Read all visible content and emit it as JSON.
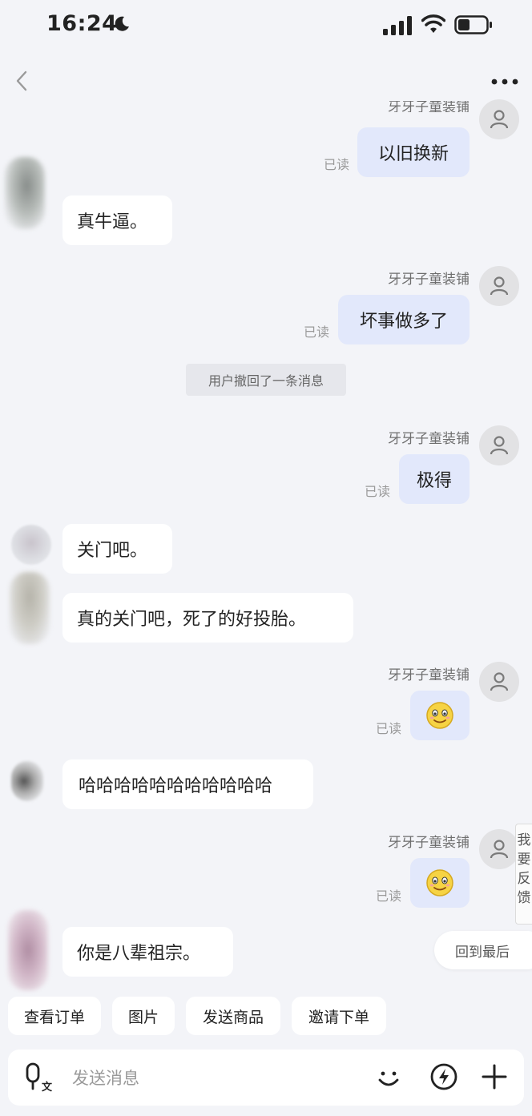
{
  "status_bar": {
    "time": "16:24"
  },
  "shop": {
    "name": "牙牙子童装铺"
  },
  "read_label": "已读",
  "messages": {
    "m1": "以旧换新",
    "m2": "真牛逼。",
    "m3": "坏事做多了",
    "recall": "用户撤回了一条消息",
    "m4": "极得",
    "m5": "关门吧。",
    "m6": "真的关门吧，死了的好投胎。",
    "m7": "哈哈哈哈哈哈哈哈哈哈哈",
    "m8": "你是八辈祖宗。"
  },
  "shop_name_cut": "牙牙子童装铺",
  "feedback": {
    "label": "我要反馈"
  },
  "back_to_latest": "回到最后",
  "quick_actions": [
    "查看订单",
    "图片",
    "发送商品",
    "邀请下单"
  ],
  "input": {
    "placeholder": "发送消息"
  },
  "icons": [
    "back-icon",
    "more-icon",
    "moon-icon",
    "signal-icon",
    "wifi-icon",
    "battery-icon",
    "person-icon",
    "smiley-icon",
    "voice-icon",
    "emoji-icon",
    "flash-icon",
    "plus-icon"
  ]
}
